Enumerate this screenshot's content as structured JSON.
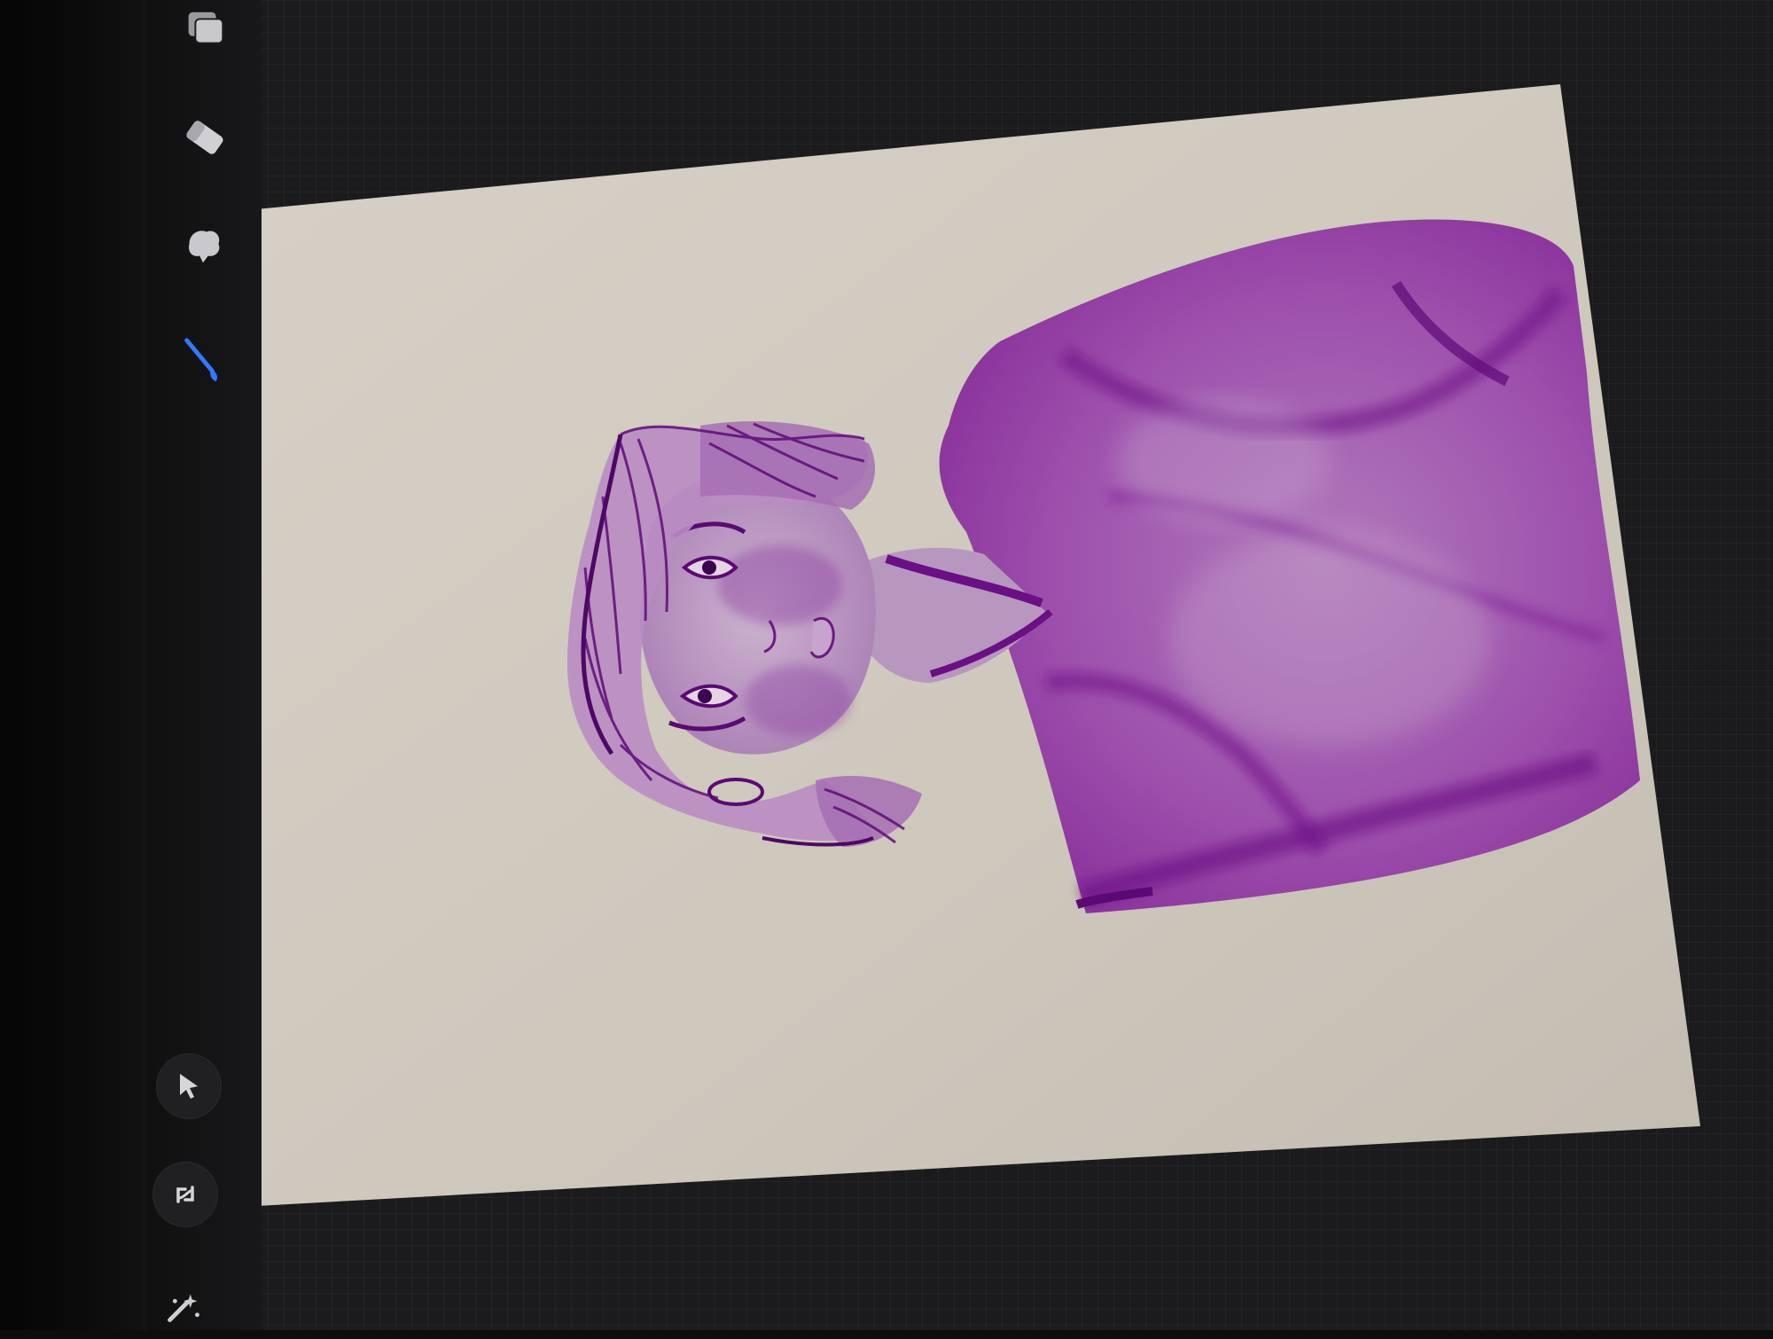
{
  "app": {
    "accent_color": "#2f7bff",
    "canvas_color": "#cfc8bd",
    "ink_color": "#8a1aa0"
  },
  "toolbar": {
    "tools": [
      {
        "id": "layers",
        "icon": "layers-icon",
        "active": false
      },
      {
        "id": "eraser",
        "icon": "eraser-icon",
        "active": false
      },
      {
        "id": "smudge",
        "icon": "smudge-icon",
        "active": false
      },
      {
        "id": "brush",
        "icon": "brush-icon",
        "active": true
      }
    ],
    "bottom_tools": [
      {
        "id": "selection",
        "icon": "cursor-arrow-icon"
      },
      {
        "id": "transform",
        "icon": "transform-icon"
      },
      {
        "id": "adjustments",
        "icon": "magic-wand-icon"
      }
    ]
  },
  "canvas": {
    "artwork": "portrait"
  }
}
